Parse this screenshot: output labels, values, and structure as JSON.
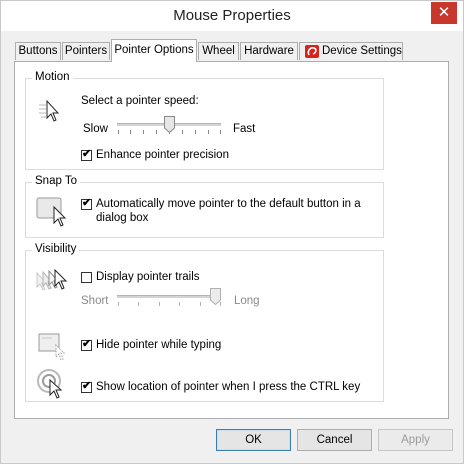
{
  "window": {
    "title": "Mouse Properties",
    "close_glyph": "✕"
  },
  "tabs": [
    {
      "label": "Buttons"
    },
    {
      "label": "Pointers"
    },
    {
      "label": "Pointer Options",
      "active": true
    },
    {
      "label": "Wheel"
    },
    {
      "label": "Hardware"
    },
    {
      "label": "Device Settings",
      "icon": "device-logo-icon"
    }
  ],
  "motion": {
    "group_title": "Motion",
    "speed_label": "Select a pointer speed:",
    "slow_label": "Slow",
    "fast_label": "Fast",
    "speed_value": 0.5,
    "precision_label": "Enhance pointer precision",
    "precision_checked": true
  },
  "snap": {
    "group_title": "Snap To",
    "label_line1": "Automatically move pointer to the default button in a",
    "label_line2": "dialog box",
    "checked": true
  },
  "visibility": {
    "group_title": "Visibility",
    "trails_label": "Display pointer trails",
    "trails_checked": false,
    "short_label": "Short",
    "long_label": "Long",
    "trails_value": 1.0,
    "hide_label": "Hide pointer while typing",
    "hide_checked": true,
    "ctrl_label": "Show location of pointer when I press the CTRL key",
    "ctrl_checked": true
  },
  "buttons": {
    "ok": "OK",
    "cancel": "Cancel",
    "apply": "Apply"
  },
  "check_glyph": "✔",
  "colors": {
    "close": "#c7372b",
    "device_logo": "#d6231c"
  }
}
